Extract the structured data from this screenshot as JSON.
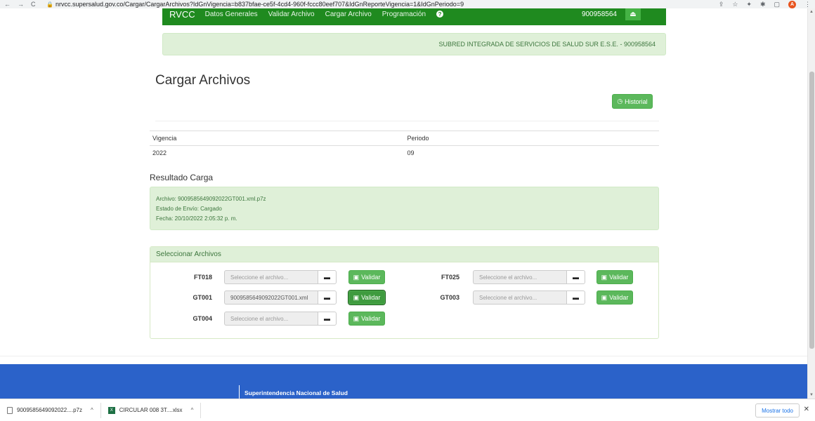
{
  "browser": {
    "url": "nrvcc.supersalud.gov.co/Cargar/CargarArchivos?IdGnVigencia=b837bfae-ce5f-4cd4-960f-fccc80eef707&IdGnReporteVigencia=1&IdGnPeriodo=9",
    "avatar": "A"
  },
  "navbar": {
    "brand": "RVCC",
    "items": [
      "Datos Generales",
      "Validar Archivo",
      "Cargar Archivo",
      "Programación"
    ],
    "help": "?",
    "nit": "900958564",
    "logout": "⏏"
  },
  "entity": "SUBRED INTEGRADA DE SERVICIOS DE SALUD SUR E.S.E. - 900958564",
  "page_title": "Cargar Archivos",
  "historial_label": "Historial",
  "info": {
    "headers": [
      "Vigencia",
      "Periodo"
    ],
    "values": [
      "2022",
      "09"
    ]
  },
  "result": {
    "title": "Resultado Carga",
    "lines": [
      "Archivo: 9009585649092022GT001.xml.p7z",
      "Estado de Envío: Cargado",
      "Fecha: 20/10/2022 2:05:32 p. m."
    ]
  },
  "panel": {
    "title": "Seleccionar Archivos",
    "validar_label": "Validar",
    "placeholder": "Seleccione el archivo...",
    "files": [
      {
        "code": "FT018",
        "value": ""
      },
      {
        "code": "FT025",
        "value": ""
      },
      {
        "code": "GT001",
        "value": "9009585649092022GT001.xml"
      },
      {
        "code": "GT003",
        "value": ""
      },
      {
        "code": "GT004",
        "value": ""
      }
    ]
  },
  "footer": {
    "name": "Superintendencia Nacional de Salud"
  },
  "downloads": {
    "items": [
      "9009585649092022....p7z",
      "CIRCULAR 008 3T....xlsx"
    ],
    "show_all": "Mostrar todo"
  },
  "colors": {
    "navbar": "#1f8a1f",
    "success_bg": "#dff0d8",
    "button": "#5cb85c",
    "footer": "#2b62c9"
  }
}
